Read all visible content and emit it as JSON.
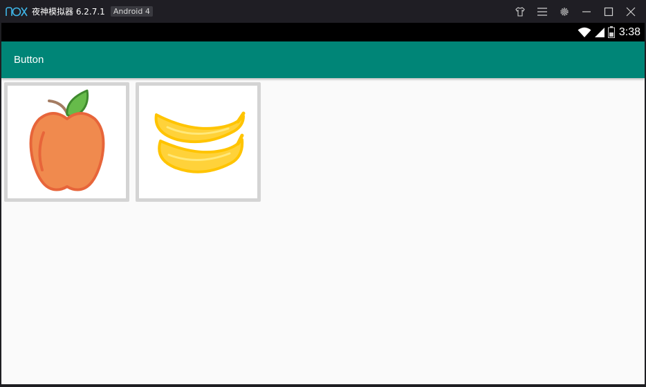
{
  "window": {
    "title": "夜神模拟器 6.2.7.1",
    "android_badge": "Android 4",
    "controls": [
      "shirt-icon",
      "menu-icon",
      "gear-icon",
      "minimize-icon",
      "maximize-icon",
      "close-icon"
    ]
  },
  "statusbar": {
    "time": "3:38",
    "icons": [
      "wifi-icon",
      "signal-icon",
      "battery-icon"
    ]
  },
  "appbar": {
    "title": "Button",
    "color": "#008577"
  },
  "buttons": [
    {
      "name": "apple-image-button",
      "icon": "apple-icon"
    },
    {
      "name": "banana-image-button",
      "icon": "banana-icon"
    }
  ],
  "colors": {
    "accent": "#008577",
    "logo": "#3fb6e8"
  }
}
